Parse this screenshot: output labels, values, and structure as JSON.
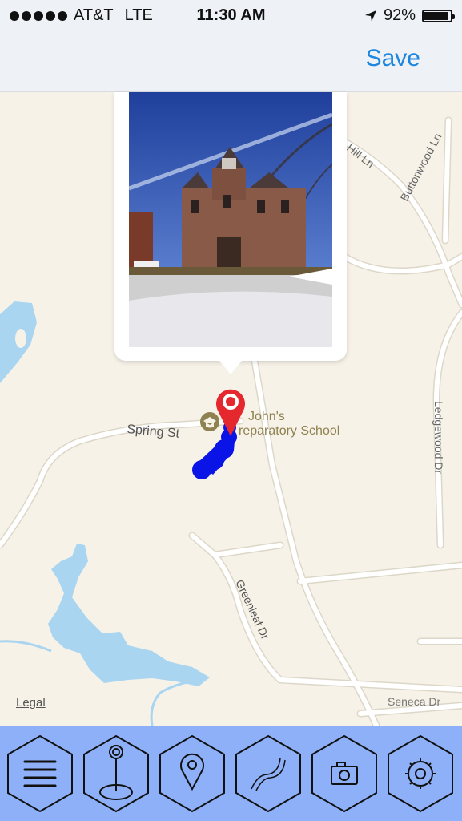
{
  "status_bar": {
    "carrier": "AT&T",
    "network": "LTE",
    "time": "11:30 AM",
    "battery_percent": "92%",
    "battery_level": 0.92,
    "signal_dots": 5
  },
  "nav_bar": {
    "save_label": "Save"
  },
  "map": {
    "streets": {
      "spring_st": "Spring St",
      "hill_ln": "Hill Ln",
      "buttonwood_ln": "Buttonwood Ln",
      "ledgewood_dr": "Ledgewood Dr",
      "greenleaf_dr": "Greenleaf Dr",
      "seneca_dr": "Seneca Dr"
    },
    "poi": {
      "line1": "John's",
      "line2": "reparatory School"
    },
    "legal_label": "Legal",
    "colors": {
      "land": "#f6f2e8",
      "water": "#a9d5f1",
      "road": "#ffffff",
      "track": "#0a14e6",
      "pin": "#e5282e",
      "poi_text": "#8f8150"
    }
  },
  "toolbar": {
    "background": "#8db0f8",
    "buttons": [
      {
        "name": "menu",
        "icon": "menu-icon"
      },
      {
        "name": "waypoint",
        "icon": "pin-stand-icon"
      },
      {
        "name": "location",
        "icon": "location-pin-icon"
      },
      {
        "name": "route",
        "icon": "route-icon"
      },
      {
        "name": "camera",
        "icon": "camera-icon"
      },
      {
        "name": "settings",
        "icon": "gear-icon"
      }
    ]
  }
}
